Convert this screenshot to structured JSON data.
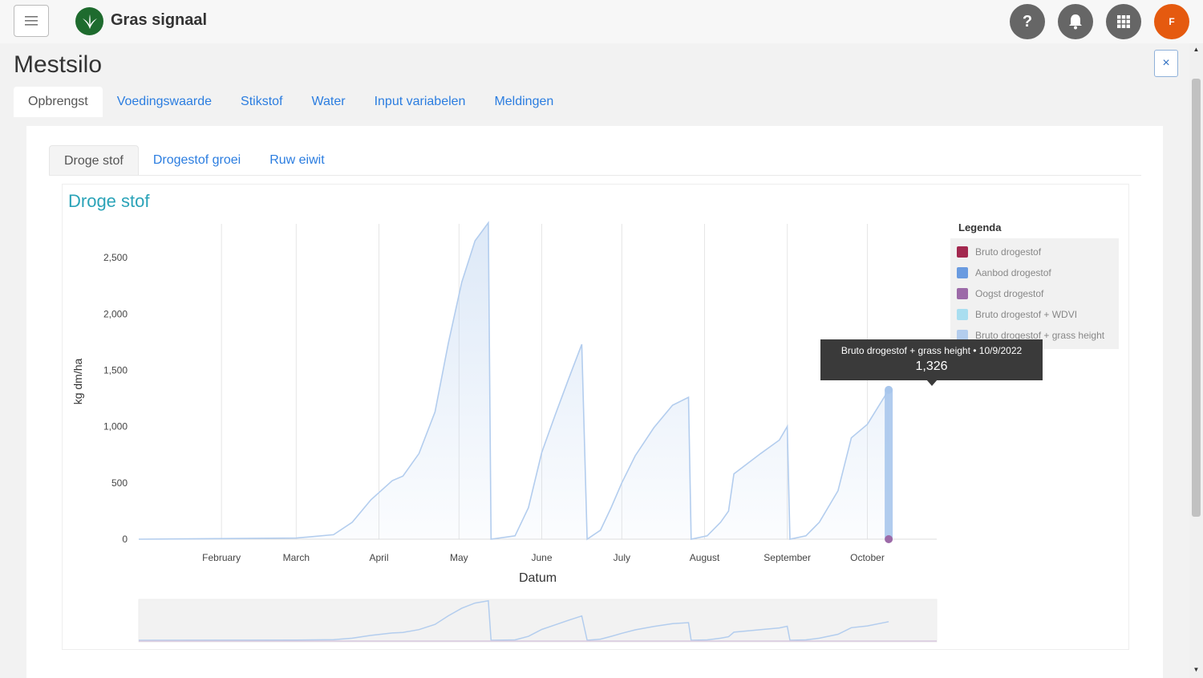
{
  "app": {
    "brand": "Gras signaal",
    "avatar_initial": "F"
  },
  "page": {
    "title": "Mestsilo",
    "close_label": "×"
  },
  "tabs_main": [
    {
      "label": "Opbrengst",
      "active": true
    },
    {
      "label": "Voedingswaarde",
      "active": false
    },
    {
      "label": "Stikstof",
      "active": false
    },
    {
      "label": "Water",
      "active": false
    },
    {
      "label": "Input variabelen",
      "active": false
    },
    {
      "label": "Meldingen",
      "active": false
    }
  ],
  "tabs_sub": [
    {
      "label": "Droge stof",
      "active": true
    },
    {
      "label": "Drogestof groei",
      "active": false
    },
    {
      "label": "Ruw eiwit",
      "active": false
    }
  ],
  "icons": {
    "menu": "hamburger-menu-icon",
    "brand": "grass-leaf-icon",
    "help": "question-mark-icon",
    "notifications": "bell-icon",
    "apps": "grid-icon",
    "close": "close-icon"
  },
  "colors": {
    "accent": "#2b7de0",
    "chart_title": "#2aa3b8",
    "avatar": "#e55a0f",
    "brand": "#1e6b2e"
  },
  "chart_data": {
    "type": "area",
    "title": "Droge stof",
    "xlabel": "Datum",
    "ylabel": "kg dm/ha",
    "ylim": [
      0,
      2800
    ],
    "yticks": [
      0,
      500,
      1000,
      1500,
      2000,
      2500
    ],
    "ytick_labels": [
      "0",
      "500",
      "1,000",
      "1,500",
      "2,000",
      "2,500"
    ],
    "xlim": [
      "2022-01-01",
      "2022-10-27"
    ],
    "xticks": [
      {
        "date": "2022-02-01",
        "label": "February"
      },
      {
        "date": "2022-03-01",
        "label": "March"
      },
      {
        "date": "2022-04-01",
        "label": "April"
      },
      {
        "date": "2022-05-01",
        "label": "May"
      },
      {
        "date": "2022-06-01",
        "label": "June"
      },
      {
        "date": "2022-07-01",
        "label": "July"
      },
      {
        "date": "2022-08-01",
        "label": "August"
      },
      {
        "date": "2022-09-01",
        "label": "September"
      },
      {
        "date": "2022-10-01",
        "label": "October"
      }
    ],
    "grid": true,
    "legend": {
      "title": "Legenda",
      "placement": "top-right",
      "items": [
        {
          "label": "Bruto drogestof",
          "color": "#a3284f"
        },
        {
          "label": "Aanbod drogestof",
          "color": "#6a9be0"
        },
        {
          "label": "Oogst drogestof",
          "color": "#9c6aa8"
        },
        {
          "label": "Bruto drogestof + WDVI",
          "color": "#a9def0"
        },
        {
          "label": "Bruto drogestof + grass height",
          "color": "#b3cdee"
        }
      ]
    },
    "series": [
      {
        "name": "Bruto drogestof + grass height",
        "color": "#b3cdee",
        "points": [
          [
            "2022-01-01",
            0
          ],
          [
            "2022-03-01",
            10
          ],
          [
            "2022-03-15",
            40
          ],
          [
            "2022-03-22",
            150
          ],
          [
            "2022-03-29",
            350
          ],
          [
            "2022-04-06",
            520
          ],
          [
            "2022-04-10",
            560
          ],
          [
            "2022-04-16",
            760
          ],
          [
            "2022-04-22",
            1130
          ],
          [
            "2022-04-27",
            1740
          ],
          [
            "2022-05-02",
            2280
          ],
          [
            "2022-05-07",
            2650
          ],
          [
            "2022-05-12",
            2810
          ],
          [
            "2022-05-13",
            0
          ],
          [
            "2022-05-22",
            30
          ],
          [
            "2022-05-27",
            280
          ],
          [
            "2022-06-01",
            770
          ],
          [
            "2022-06-06",
            1100
          ],
          [
            "2022-06-11",
            1420
          ],
          [
            "2022-06-16",
            1730
          ],
          [
            "2022-06-18",
            0
          ],
          [
            "2022-06-23",
            80
          ],
          [
            "2022-06-27",
            280
          ],
          [
            "2022-07-01",
            500
          ],
          [
            "2022-07-06",
            740
          ],
          [
            "2022-07-13",
            990
          ],
          [
            "2022-07-20",
            1190
          ],
          [
            "2022-07-26",
            1260
          ],
          [
            "2022-07-27",
            0
          ],
          [
            "2022-08-02",
            30
          ],
          [
            "2022-08-07",
            150
          ],
          [
            "2022-08-10",
            250
          ],
          [
            "2022-08-12",
            580
          ],
          [
            "2022-08-22",
            760
          ],
          [
            "2022-08-29",
            880
          ],
          [
            "2022-09-01",
            1000
          ],
          [
            "2022-09-02",
            0
          ],
          [
            "2022-09-08",
            30
          ],
          [
            "2022-09-13",
            150
          ],
          [
            "2022-09-20",
            430
          ],
          [
            "2022-09-25",
            900
          ],
          [
            "2022-10-01",
            1020
          ],
          [
            "2022-10-09",
            1326
          ]
        ]
      }
    ],
    "tooltip": {
      "series": "Bruto drogestof + grass height",
      "date": "10/9/2022",
      "label": "Bruto drogestof + grass height • 10/9/2022",
      "value": "1,326"
    }
  }
}
